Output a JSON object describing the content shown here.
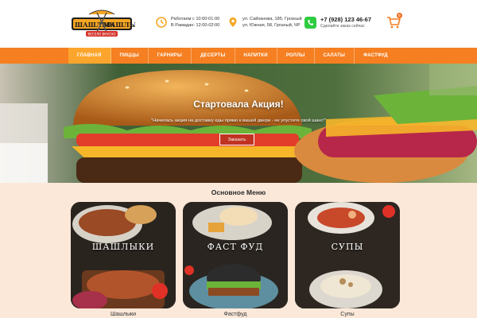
{
  "brand": {
    "logo_text_top": "ШАШЛЫК",
    "logo_text_bottom": "МАШЛЫК",
    "logo_sub": "ВЕСЕЛО ВКУСНО",
    "accent": "#f57f21"
  },
  "header": {
    "hours": {
      "icon": "clock-icon",
      "line1": "Работаем с 10:00-01:00",
      "line2": "В Рамадан: 12:00-02:00"
    },
    "address": {
      "icon": "location-pin-icon",
      "line1": "ул. Сайханова, 185, Грозный",
      "line2": "ул. Южная, 58, Грозный, ЧР"
    },
    "phone": {
      "icon": "whatsapp-icon",
      "number": "+7 (928) 123 46-67",
      "sub": "Сделайте заказ сейчас"
    },
    "cart": {
      "icon": "cart-icon",
      "count": "0"
    }
  },
  "nav": {
    "items": [
      {
        "label": "ГЛАВНАЯ",
        "active": true
      },
      {
        "label": "ПИЦЦЫ"
      },
      {
        "label": "ГАРНИРЫ"
      },
      {
        "label": "ДЕСЕРТЫ"
      },
      {
        "label": "НАПИТКИ"
      },
      {
        "label": "РОЛЛЫ"
      },
      {
        "label": "САЛАТЫ"
      },
      {
        "label": "ФАСТФУД"
      }
    ]
  },
  "hero": {
    "title": "Стартовала Акция!",
    "subtitle": "\"Начилась акция на доставку еды прямо к вашей двери - не упустите свой шанс!\"",
    "button": "Заказать"
  },
  "menu": {
    "title": "Основное Меню",
    "cards": [
      {
        "label": "ШАШЛЫКИ",
        "caption": "Шашлыки"
      },
      {
        "label": "ФАСТ ФУД",
        "caption": "Фастфуд"
      },
      {
        "label": "СУПЫ",
        "caption": "Супы"
      }
    ]
  }
}
